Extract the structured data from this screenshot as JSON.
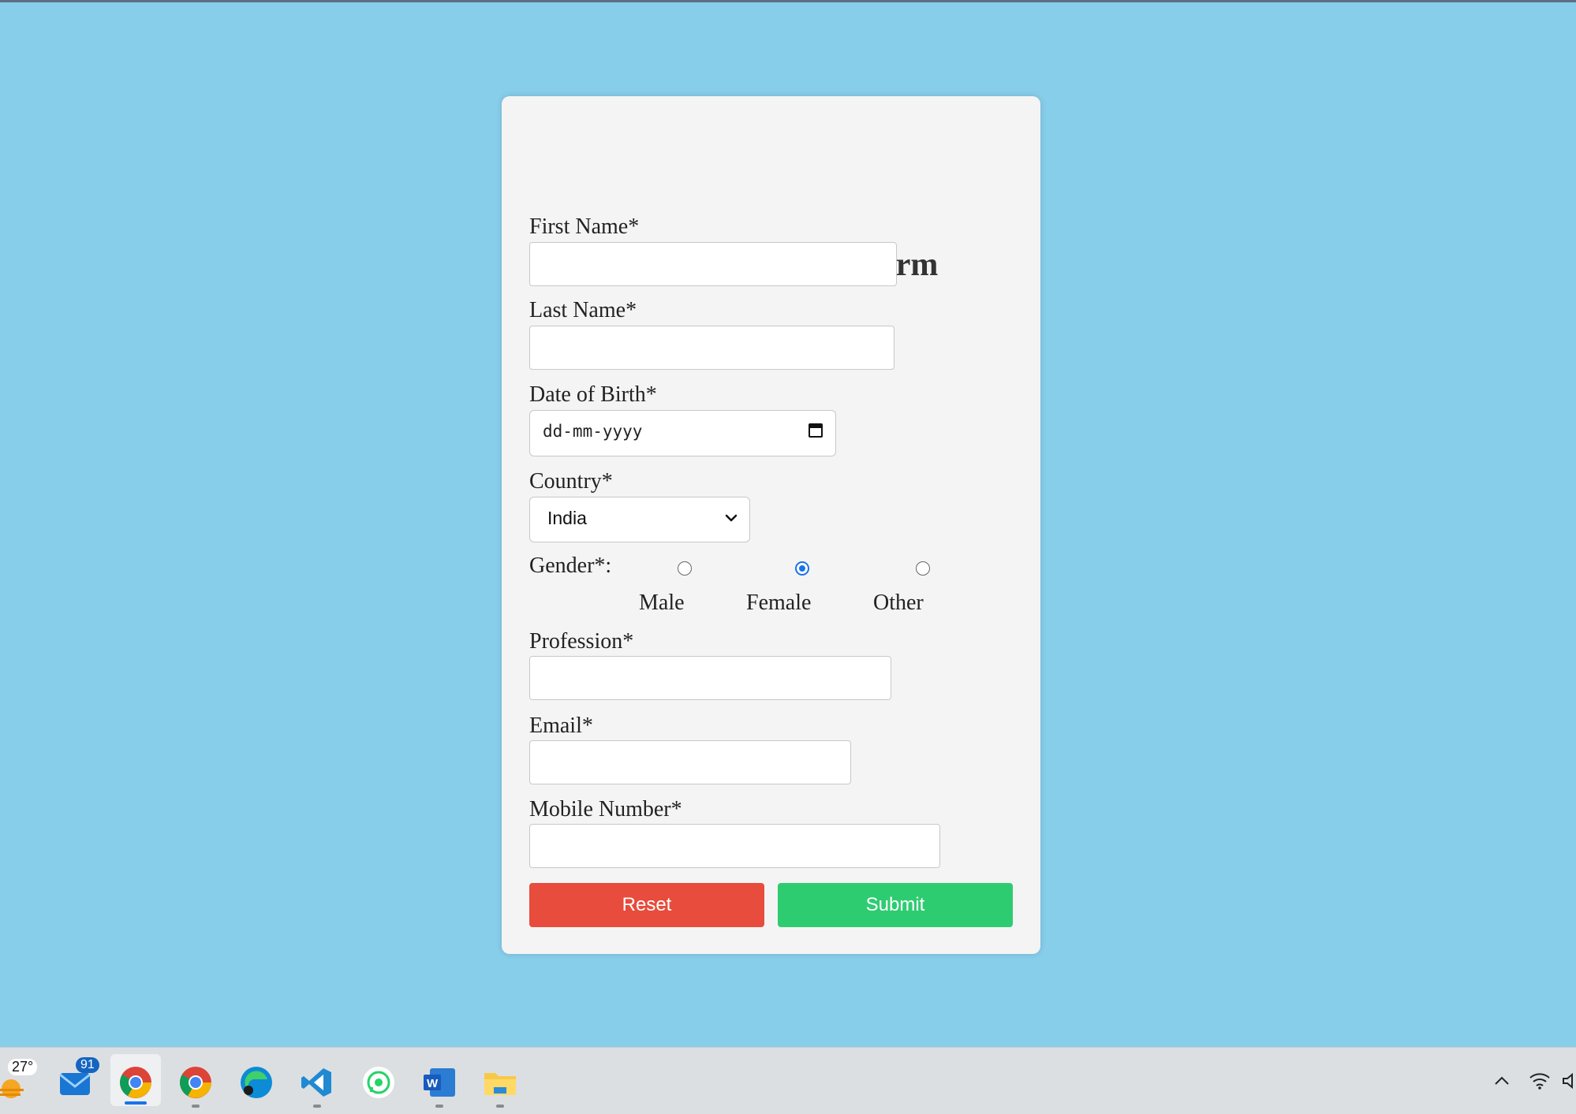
{
  "form": {
    "title": "Customer Survey Form",
    "first_name_label": "First Name*",
    "last_name_label": "Last Name*",
    "dob_label": "Date of Birth*",
    "dob_placeholder": "dd-mm-yyyy",
    "country_label": "Country*",
    "country_value": "India",
    "gender_label": "Gender*:",
    "gender_options": [
      "Male",
      "Female",
      "Other"
    ],
    "gender_selected": "Female",
    "profession_label": "Profession*",
    "email_label": "Email*",
    "mobile_label": "Mobile Number*",
    "reset_label": "Reset",
    "submit_label": "Submit"
  },
  "colors": {
    "background": "#87ceeb",
    "card": "#f4f4f4",
    "reset": "#e74c3c",
    "submit": "#2ecc71",
    "radio_accent": "#1a73e8"
  },
  "taskbar": {
    "weather_temp": "27°",
    "mail_badge": "91",
    "apps": [
      "weather-icon",
      "mail-icon",
      "chrome-icon",
      "chrome-profile-icon",
      "edge-icon",
      "vscode-icon",
      "whatsapp-icon",
      "word-icon",
      "file-explorer-icon"
    ],
    "tray": [
      "chevron-up-icon",
      "wifi-icon",
      "volume-icon"
    ]
  }
}
